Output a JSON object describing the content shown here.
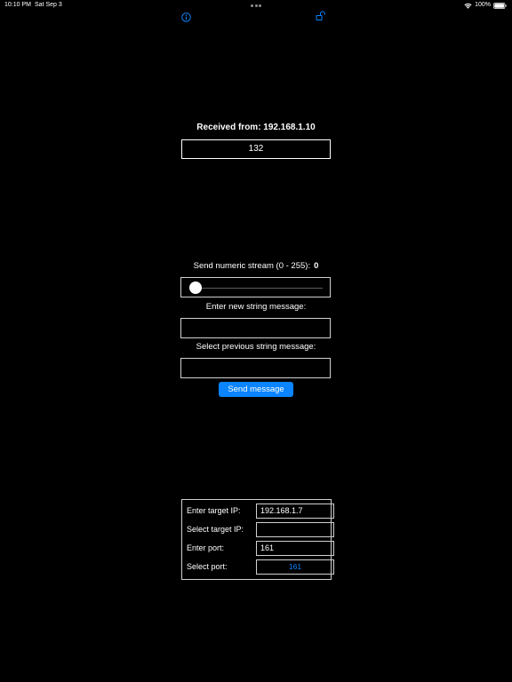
{
  "status_bar": {
    "time": "10:10 PM",
    "date": "Sat Sep 3",
    "battery": "100%"
  },
  "toolbar": {
    "info_icon": "info-circle-icon",
    "lock_icon": "rotation-lock-icon"
  },
  "received": {
    "label": "Received from: 192.168.1.10",
    "value": "132"
  },
  "stream": {
    "label": "Send numeric stream (0 - 255):",
    "value": "0",
    "slider_fraction": 0
  },
  "new_message": {
    "label": "Enter new string message:",
    "value": ""
  },
  "previous_message": {
    "label": "Select previous string message:",
    "value": ""
  },
  "send_button": {
    "label": "Send message"
  },
  "target": {
    "ip_label": "Enter target IP:",
    "ip_value": "192.168.1.7",
    "select_ip_label": "Select target IP:",
    "select_ip_value": "",
    "port_label": "Enter port:",
    "port_value": "161",
    "select_port_label": "Select port:",
    "select_port_value": "161"
  },
  "colors": {
    "accent": "#0a84ff",
    "background": "#000000"
  }
}
